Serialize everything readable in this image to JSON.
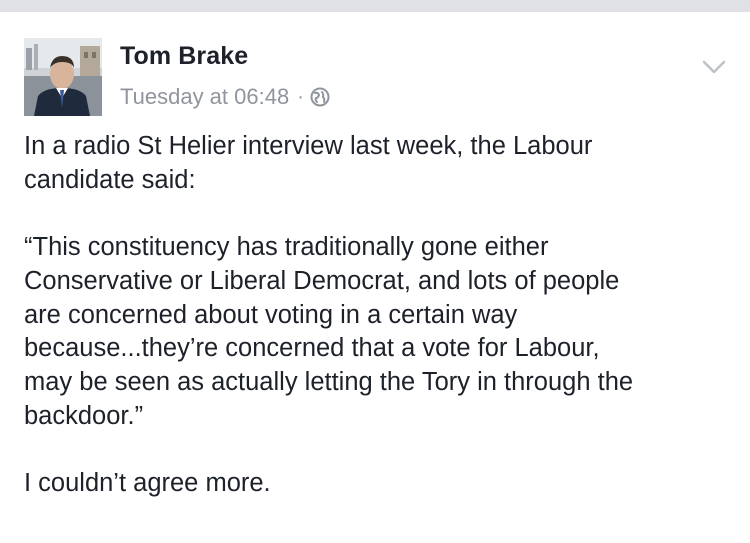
{
  "post": {
    "author": "Tom Brake",
    "timestamp": "Tuesday at 06:48",
    "separator": "·",
    "privacy_icon": "globe-icon",
    "menu_icon": "chevron-down-icon",
    "avatar_icon": "profile-photo",
    "paragraphs": [
      "In a radio St Helier interview last week, the Labour\ncandidate said:",
      "“This constituency has traditionally gone either\nConservative or Liberal Democrat, and lots of people\nare concerned about voting in a certain way\nbecause...they’re concerned that a vote for Labour,\nmay be seen as actually letting the Tory in through the\nbackdoor.”",
      "I couldn’t agree more."
    ]
  },
  "colors": {
    "name": "#1d2129",
    "meta": "#90949c",
    "body_text": "#1d2129",
    "top_strip": "#e0e1e5",
    "background": "#ffffff"
  }
}
